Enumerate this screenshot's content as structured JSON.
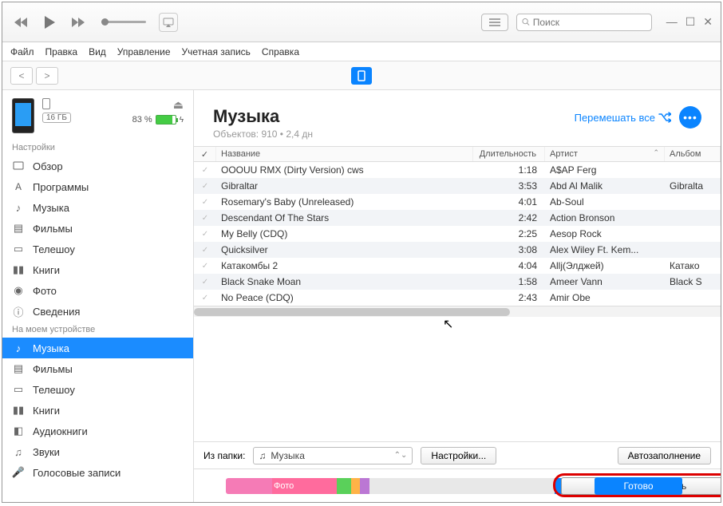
{
  "menubar": [
    "Файл",
    "Правка",
    "Вид",
    "Управление",
    "Учетная запись",
    "Справка"
  ],
  "search": {
    "placeholder": "Поиск"
  },
  "device": {
    "storage_label": "16 ГБ",
    "battery_percent": "83 %"
  },
  "sidebar": {
    "section_settings": "Настройки",
    "settings_items": [
      {
        "id": "overview",
        "label": "Обзор"
      },
      {
        "id": "apps",
        "label": "Программы"
      },
      {
        "id": "music",
        "label": "Музыка"
      },
      {
        "id": "movies",
        "label": "Фильмы"
      },
      {
        "id": "tv",
        "label": "Телешоу"
      },
      {
        "id": "books",
        "label": "Книги"
      },
      {
        "id": "photos",
        "label": "Фото"
      },
      {
        "id": "info",
        "label": "Сведения"
      }
    ],
    "section_device": "На моем устройстве",
    "device_items": [
      {
        "id": "d-music",
        "label": "Музыка",
        "active": true
      },
      {
        "id": "d-movies",
        "label": "Фильмы"
      },
      {
        "id": "d-tv",
        "label": "Телешоу"
      },
      {
        "id": "d-books",
        "label": "Книги"
      },
      {
        "id": "d-audiobooks",
        "label": "Аудиокниги"
      },
      {
        "id": "d-tones",
        "label": "Звуки"
      },
      {
        "id": "d-voice",
        "label": "Голосовые записи"
      }
    ]
  },
  "main": {
    "title": "Музыка",
    "subtitle": "Объектов: 910 • 2,4 дн",
    "shuffle_label": "Перемешать все"
  },
  "table": {
    "headers": {
      "check": "✓",
      "name": "Название",
      "duration": "Длительность",
      "artist": "Артист",
      "album": "Альбом"
    },
    "rows": [
      {
        "name": "OOOUU RMX  (Dirty Version) cws",
        "dur": "1:18",
        "artist": "A$AP Ferg",
        "album": ""
      },
      {
        "name": "Gibraltar",
        "dur": "3:53",
        "artist": "Abd Al Malik",
        "album": "Gibralta"
      },
      {
        "name": "Rosemary's Baby (Unreleased)",
        "dur": "4:01",
        "artist": "Ab-Soul",
        "album": ""
      },
      {
        "name": "Descendant Of The Stars",
        "dur": "2:42",
        "artist": "Action Bronson",
        "album": ""
      },
      {
        "name": "My Belly (CDQ)",
        "dur": "2:25",
        "artist": "Aesop Rock",
        "album": ""
      },
      {
        "name": "Quicksilver",
        "dur": "3:08",
        "artist": "Alex Wiley Ft. Kem...",
        "album": ""
      },
      {
        "name": "Катакомбы 2",
        "dur": "4:04",
        "artist": "Allj(Элджей)",
        "album": "Катако"
      },
      {
        "name": "Black Snake Moan",
        "dur": "1:58",
        "artist": "Ameer Vann",
        "album": "Black S"
      },
      {
        "name": "No Peace (CDQ)",
        "dur": "2:43",
        "artist": "Amir Obe",
        "album": ""
      }
    ]
  },
  "folder": {
    "prefix": "Из папки:",
    "value": "Музыка",
    "settings_btn": "Настройки...",
    "autofill_btn": "Автозаполнение"
  },
  "bottom": {
    "photo_label": "Фото",
    "sync_label": "Синхронизировать",
    "done_label": "Готово"
  }
}
